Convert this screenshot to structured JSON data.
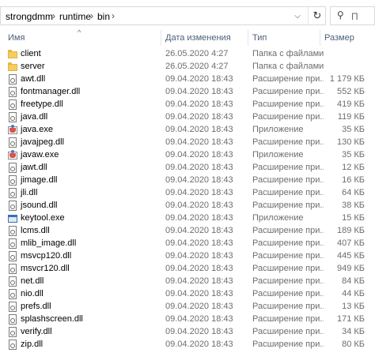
{
  "address": {
    "crumbs": [
      "strongdmm",
      "runtime",
      "bin"
    ],
    "separator": "›",
    "dropdown_glyph": "⌵",
    "refresh_glyph": "↻"
  },
  "search": {
    "placeholder": "Поиск: bin",
    "icon": "search-icon",
    "visible_text": "П"
  },
  "columns": {
    "name": "Имя",
    "date": "Дата изменения",
    "type": "Тип",
    "size": "Размер",
    "sort_indicator": "^"
  },
  "files": [
    {
      "name": "client",
      "date": "26.05.2020 4:27",
      "type": "Папка с файлами",
      "size": "",
      "icon": "folder-icon"
    },
    {
      "name": "server",
      "date": "26.05.2020 4:27",
      "type": "Папка с файлами",
      "size": "",
      "icon": "folder-icon"
    },
    {
      "name": "awt.dll",
      "date": "09.04.2020 18:43",
      "type": "Расширение при...",
      "size": "1 179 КБ",
      "icon": "dll-icon"
    },
    {
      "name": "fontmanager.dll",
      "date": "09.04.2020 18:43",
      "type": "Расширение при...",
      "size": "552 КБ",
      "icon": "dll-icon"
    },
    {
      "name": "freetype.dll",
      "date": "09.04.2020 18:43",
      "type": "Расширение при...",
      "size": "419 КБ",
      "icon": "dll-icon"
    },
    {
      "name": "java.dll",
      "date": "09.04.2020 18:43",
      "type": "Расширение при...",
      "size": "119 КБ",
      "icon": "dll-icon"
    },
    {
      "name": "java.exe",
      "date": "09.04.2020 18:43",
      "type": "Приложение",
      "size": "35 КБ",
      "icon": "java-exe-icon"
    },
    {
      "name": "javajpeg.dll",
      "date": "09.04.2020 18:43",
      "type": "Расширение при...",
      "size": "130 КБ",
      "icon": "dll-icon"
    },
    {
      "name": "javaw.exe",
      "date": "09.04.2020 18:43",
      "type": "Приложение",
      "size": "35 КБ",
      "icon": "java-exe-icon"
    },
    {
      "name": "jawt.dll",
      "date": "09.04.2020 18:43",
      "type": "Расширение при...",
      "size": "12 КБ",
      "icon": "dll-icon"
    },
    {
      "name": "jimage.dll",
      "date": "09.04.2020 18:43",
      "type": "Расширение при...",
      "size": "16 КБ",
      "icon": "dll-icon"
    },
    {
      "name": "jli.dll",
      "date": "09.04.2020 18:43",
      "type": "Расширение при...",
      "size": "64 КБ",
      "icon": "dll-icon"
    },
    {
      "name": "jsound.dll",
      "date": "09.04.2020 18:43",
      "type": "Расширение при...",
      "size": "38 КБ",
      "icon": "dll-icon"
    },
    {
      "name": "keytool.exe",
      "date": "09.04.2020 18:43",
      "type": "Приложение",
      "size": "15 КБ",
      "icon": "app-exe-icon"
    },
    {
      "name": "lcms.dll",
      "date": "09.04.2020 18:43",
      "type": "Расширение при...",
      "size": "189 КБ",
      "icon": "dll-icon"
    },
    {
      "name": "mlib_image.dll",
      "date": "09.04.2020 18:43",
      "type": "Расширение при...",
      "size": "407 КБ",
      "icon": "dll-icon"
    },
    {
      "name": "msvcp120.dll",
      "date": "09.04.2020 18:43",
      "type": "Расширение при...",
      "size": "445 КБ",
      "icon": "dll-icon"
    },
    {
      "name": "msvcr120.dll",
      "date": "09.04.2020 18:43",
      "type": "Расширение при...",
      "size": "949 КБ",
      "icon": "dll-icon"
    },
    {
      "name": "net.dll",
      "date": "09.04.2020 18:43",
      "type": "Расширение при...",
      "size": "84 КБ",
      "icon": "dll-icon"
    },
    {
      "name": "nio.dll",
      "date": "09.04.2020 18:43",
      "type": "Расширение при...",
      "size": "44 КБ",
      "icon": "dll-icon"
    },
    {
      "name": "prefs.dll",
      "date": "09.04.2020 18:43",
      "type": "Расширение при...",
      "size": "13 КБ",
      "icon": "dll-icon"
    },
    {
      "name": "splashscreen.dll",
      "date": "09.04.2020 18:43",
      "type": "Расширение при...",
      "size": "171 КБ",
      "icon": "dll-icon"
    },
    {
      "name": "verify.dll",
      "date": "09.04.2020 18:43",
      "type": "Расширение при...",
      "size": "34 КБ",
      "icon": "dll-icon"
    },
    {
      "name": "zip.dll",
      "date": "09.04.2020 18:43",
      "type": "Расширение при...",
      "size": "80 КБ",
      "icon": "dll-icon"
    }
  ]
}
